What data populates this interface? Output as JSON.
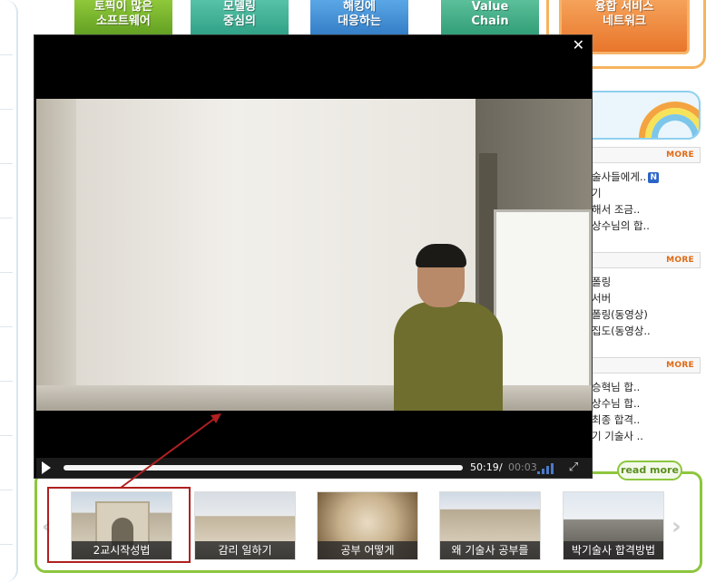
{
  "banners": [
    {
      "line1": "토픽이 많은",
      "line2": "소프트웨어"
    },
    {
      "line1": "모델링",
      "line2": "중심의"
    },
    {
      "line1": "해킹에",
      "line2": "대응하는"
    },
    {
      "line1": "Value",
      "line2": "Chain"
    },
    {
      "line1": "융합 서비스",
      "line2": "네트워크"
    }
  ],
  "right_column": {
    "more_label": "MORE",
    "section1": [
      "술사들에게..",
      "기",
      "해서 조금..",
      "상수님의 합.."
    ],
    "section1_new_badge": "N",
    "section2": [
      "폴링",
      "서버",
      "폴링(동영상)",
      "집도(동영상.."
    ],
    "section3": [
      "승혁님 합..",
      "상수님 합..",
      "최종 합격..",
      "기 기술사 .."
    ]
  },
  "player": {
    "close_symbol": "✕",
    "time_current": "50:19",
    "time_separator": "/",
    "time_total": "00:03",
    "fullscreen_symbol": "⤢"
  },
  "special": {
    "read_more": "read more",
    "prev_symbol": "‹",
    "next_symbol": "›",
    "thumbnails": [
      {
        "caption": "2교시작성법"
      },
      {
        "caption": "감리 일하기"
      },
      {
        "caption": "공부 어떻게"
      },
      {
        "caption": "왜 기술사 공부를"
      },
      {
        "caption": "박기술사 합격방법"
      }
    ]
  },
  "colors": {
    "green_accent": "#8dc63f",
    "orange_accent": "#f6b45e",
    "highlight_red": "#b02020",
    "more_orange": "#e06a14"
  }
}
